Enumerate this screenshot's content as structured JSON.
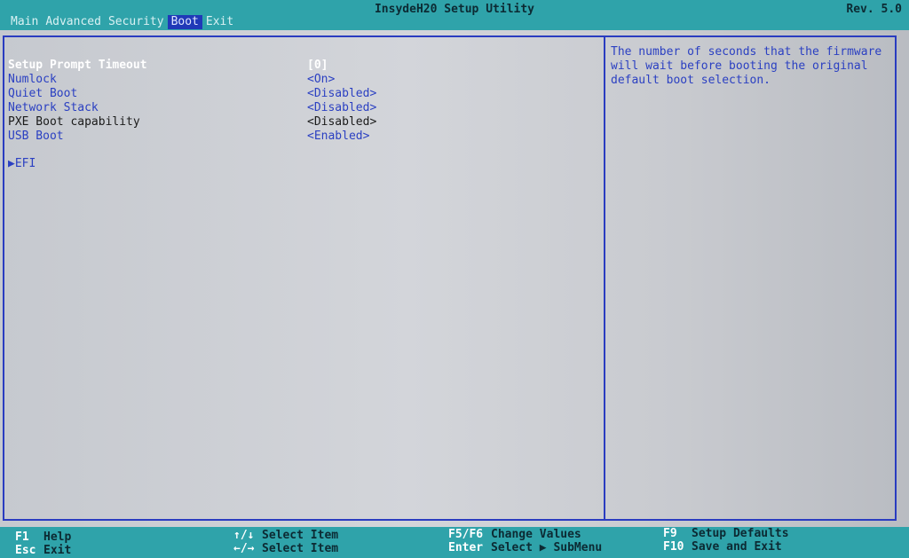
{
  "header": {
    "title": "InsydeH20 Setup Utility",
    "revision": "Rev. 5.0"
  },
  "menu": {
    "tabs": [
      {
        "label": "Main"
      },
      {
        "label": "Advanced"
      },
      {
        "label": "Security"
      },
      {
        "label": "Boot",
        "active": true
      },
      {
        "label": "Exit"
      }
    ]
  },
  "options": [
    {
      "label": "Setup Prompt Timeout",
      "value": "[0]",
      "state": "selected"
    },
    {
      "label": "Numlock",
      "value": "<On>",
      "state": "normal"
    },
    {
      "label": "Quiet Boot",
      "value": "<Disabled>",
      "state": "normal"
    },
    {
      "label": "Network Stack",
      "value": "<Disabled>",
      "state": "normal"
    },
    {
      "label": "PXE Boot capability",
      "value": "<Disabled>",
      "state": "readonly"
    },
    {
      "label": "USB Boot",
      "value": "<Enabled>",
      "state": "normal"
    }
  ],
  "submenu": {
    "arrow": "▶",
    "label": "EFI"
  },
  "help": {
    "lines": [
      "The number of seconds that the firmware",
      "will wait before booting the original",
      "default boot selection."
    ]
  },
  "footer": {
    "col1": [
      {
        "key": "F1",
        "desc": "Help"
      },
      {
        "key": "Esc",
        "desc": "Exit"
      }
    ],
    "col2": [
      {
        "key": "↑/↓",
        "desc": "Select Item"
      },
      {
        "key": "←/→",
        "desc": "Select Item"
      }
    ],
    "col3": [
      {
        "key": "F5/F6",
        "desc": "Change Values"
      },
      {
        "key": "Enter",
        "desc": "Select ▶ SubMenu"
      }
    ],
    "col4": [
      {
        "key": "F9",
        "desc": "Setup Defaults"
      },
      {
        "key": "F10",
        "desc": "Save and Exit"
      }
    ]
  },
  "colors": {
    "header_bg": "#2fa3aa",
    "active_tab_bg": "#2039b8",
    "option_text": "#2b40c2",
    "selected_text": "#ffffff",
    "frame_border": "#2a3cc0"
  }
}
